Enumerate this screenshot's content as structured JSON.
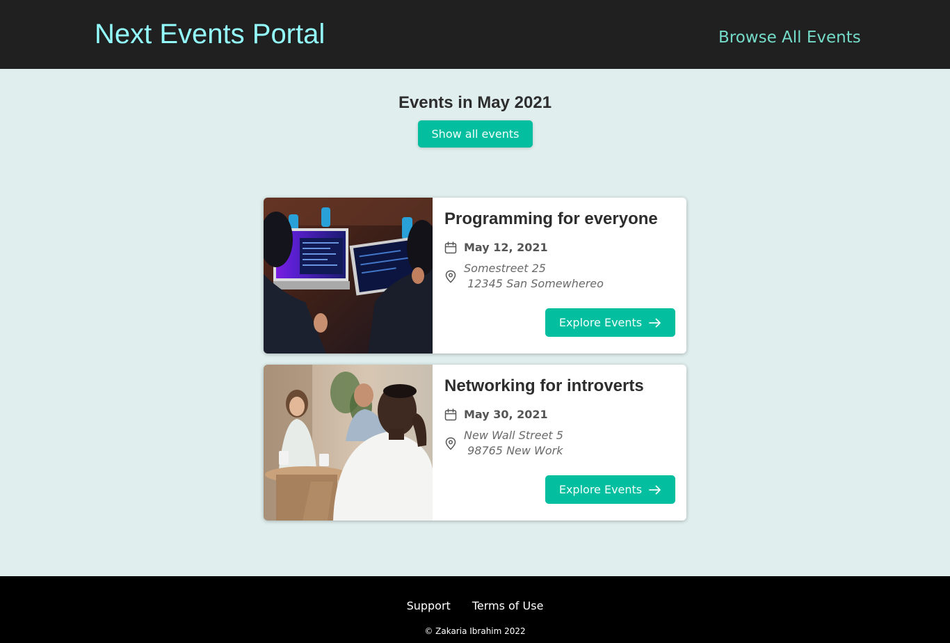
{
  "header": {
    "logo": "Next Events Portal",
    "nav_link": "Browse All Events"
  },
  "summary": {
    "title": "Events in May 2021",
    "show_all_label": "Show all events"
  },
  "events": [
    {
      "title": "Programming for everyone",
      "date": "May 12, 2021",
      "address": "Somestreet 25\n 12345 San Somewhereo",
      "button_label": "Explore Events",
      "image": "laptops-coding-photo"
    },
    {
      "title": "Networking for introverts",
      "date": "May 30, 2021",
      "address": "New Wall Street 5\n 98765 New Work",
      "button_label": "Explore Events",
      "image": "cafe-people-photo"
    }
  ],
  "footer": {
    "links": [
      "Support",
      "Terms of Use"
    ],
    "copyright": "© Zakaria Ibrahim 2022"
  },
  "colors": {
    "accent": "#03be9f",
    "logo": "#94fdfd",
    "nav_link": "#74dcc8",
    "header_bg": "#202020",
    "page_bg": "#e0efee",
    "footer_bg": "#000000"
  },
  "icons": [
    "calendar-icon",
    "location-pin-icon",
    "arrow-right-icon"
  ]
}
